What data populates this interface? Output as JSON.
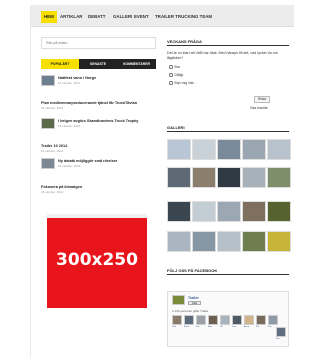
{
  "nav": {
    "items": [
      "Hem",
      "Artiklar",
      "Debatt",
      "Galleri",
      "Event",
      "Trailer Trucking Team"
    ],
    "active_index": 0
  },
  "search": {
    "placeholder": "Sök på sidan..."
  },
  "tabs": [
    "Populärt",
    "Senaste",
    "Kommentarer"
  ],
  "posts": [
    {
      "title": "Nattfest vann i Norge",
      "date": "15 oktober, 2014",
      "has_thumb": true
    },
    {
      "title": "Plan medlemmarproducerande tjänst får TruckTävlan",
      "date": "15 oktober, 2014",
      "has_thumb": false
    },
    {
      "title": "I helgen avgörs Skandinaviens Truck Trophy",
      "date": "15 oktober, 2014",
      "has_thumb": true
    },
    {
      "title": "Trailer 10 2014",
      "date": "15 oktober, 2014",
      "has_thumb": false
    },
    {
      "title": "Ny datatk möjliggör små rörelser",
      "date": "15 oktober, 2014",
      "has_thumb": true
    },
    {
      "title": "Fokusera på klimatgen",
      "date": "15 oktober, 2014",
      "has_thumb": false
    }
  ],
  "ad": {
    "label": "300x250"
  },
  "poll": {
    "heading": "Veckans fråga",
    "question": "Det är nu klart att VAB har ökat. Med hänsyn till det, vad tycker du om åtgärden?",
    "options": [
      "Bra",
      "Dåligt",
      "Bryr mig inte..."
    ],
    "vote_label": "Rösta",
    "results_label": "Visa resultat"
  },
  "gallery": {
    "heading": "Galleri"
  },
  "facebook": {
    "heading": "Följ oss på Facebook",
    "page_name": "Trailer",
    "like_label": "Gilla",
    "likes_text": "4 126 personer gillar Trailer",
    "people": [
      "Joel",
      "Kenn",
      "Jan",
      "Rob",
      "Ulf",
      "Lars",
      "Anna",
      "Per",
      "Kim",
      "Eva"
    ]
  },
  "colors": {
    "accent": "#f7e000",
    "ad_red": "#e8141b",
    "dark": "#222222"
  }
}
